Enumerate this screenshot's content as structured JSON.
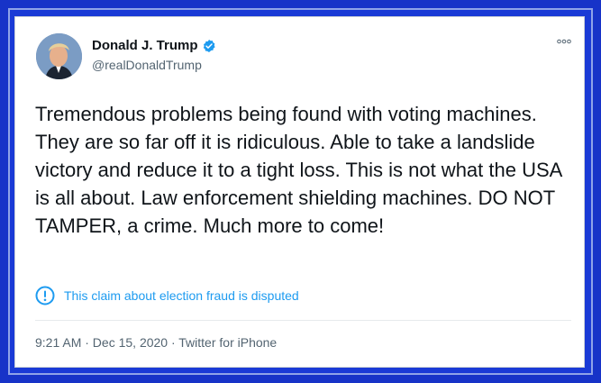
{
  "tweet": {
    "author_name": "Donald J. Trump",
    "author_handle": "@realDonaldTrump",
    "verified": true,
    "text": "Tremendous problems being found with voting machines. They are so far off it is ridiculous. Able to take a landslide victory and reduce it to a tight loss. This is not what the USA is all about. Law enforcement shielding machines. DO NOT TAMPER, a crime. Much more to come!",
    "label": "This claim about election fraud is disputed",
    "meta": "9:21 AM · Dec 15, 2020 · Twitter for iPhone"
  },
  "colors": {
    "frame_blue": "#1733c8",
    "link_blue": "#1d9bf0",
    "text": "#0f1419",
    "muted": "#536471"
  },
  "icons": {
    "verified": "verified-badge-icon",
    "more": "more-options-icon",
    "info": "exclamation-circle-icon"
  }
}
